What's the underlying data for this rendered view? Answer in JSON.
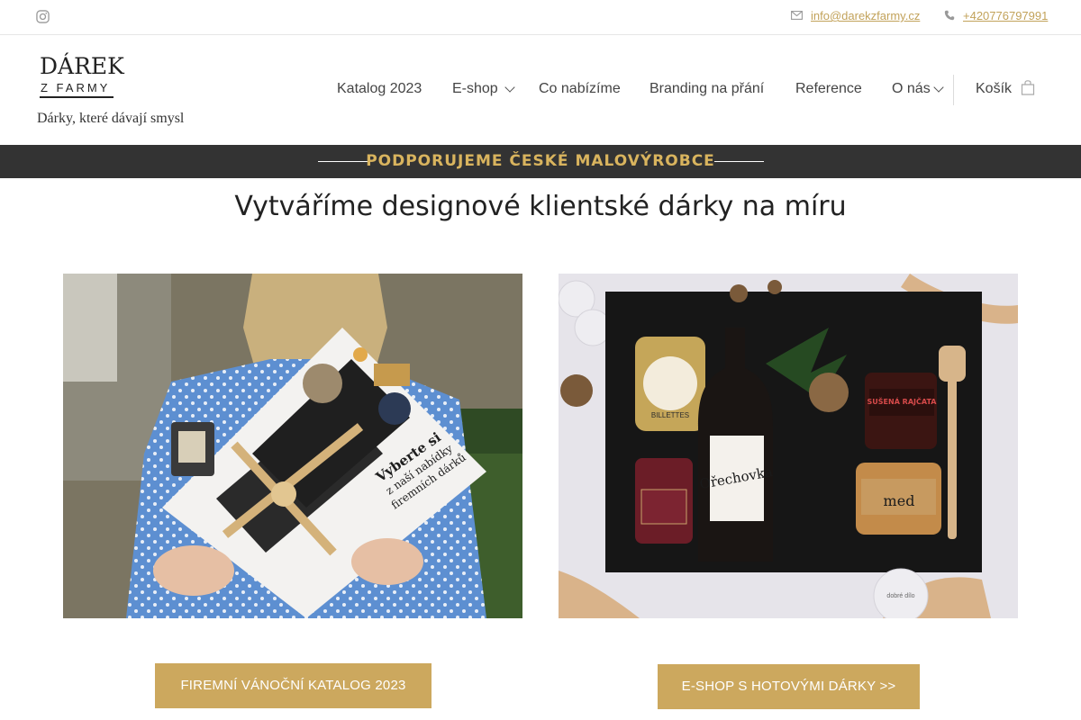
{
  "topbar": {
    "email": "info@darekzfarmy.cz",
    "phone": "+420776797991"
  },
  "logo": {
    "line1": "DÁREK",
    "line2": "Z FARMY"
  },
  "tagline": "Dárky, které dávají smysl",
  "nav": {
    "items": [
      {
        "label": "Katalog 2023",
        "has_dropdown": false
      },
      {
        "label": "E-shop",
        "has_dropdown": true
      },
      {
        "label": "Co nabízíme",
        "has_dropdown": false
      },
      {
        "label": "Branding na přání",
        "has_dropdown": false
      },
      {
        "label": "Reference",
        "has_dropdown": false
      },
      {
        "label": "O nás",
        "has_dropdown": true
      }
    ],
    "cart_label": "Košík"
  },
  "banner": {
    "text": "PODPORUJEME ČESKÉ MALOVÝROBCE"
  },
  "headline": "Vytváříme designové klientské dárky na míru",
  "left_card": {
    "caption_line1": "Vyberte si",
    "caption_line2": "z naší nabídky",
    "caption_line3": "firemních dárků",
    "button": "FIREMNÍ VÁNOČNÍ KATALOG 2023"
  },
  "right_card": {
    "jar1": "BILLETTES",
    "bottle": "Ořechovka",
    "jar2": "SUŠENÁ RAJČATA",
    "jar3": "med",
    "jar4": "dobré dílo",
    "button": "E-SHOP S HOTOVÝMI DÁRKY >>"
  },
  "colors": {
    "accent": "#cca85e",
    "banner_bg": "#333333",
    "banner_text": "#d9b45e",
    "link": "#c2a25a"
  }
}
